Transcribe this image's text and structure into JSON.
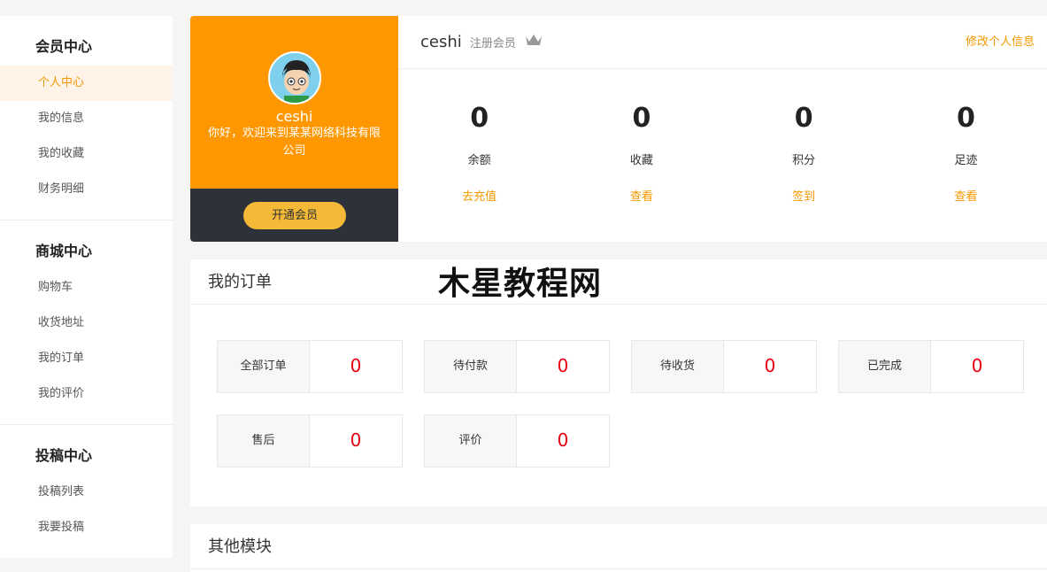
{
  "sidebar": {
    "groups": [
      {
        "title": "会员中心",
        "items": [
          "个人中心",
          "我的信息",
          "我的收藏",
          "财务明细"
        ]
      },
      {
        "title": "商城中心",
        "items": [
          "购物车",
          "收货地址",
          "我的订单",
          "我的评价"
        ]
      },
      {
        "title": "投稿中心",
        "items": [
          "投稿列表",
          "我要投稿"
        ]
      }
    ],
    "active_item": "个人中心"
  },
  "profile": {
    "name": "ceshi",
    "greeting": "你好，欢迎来到某某网络科技有限公司",
    "open_vip_label": "开通会员",
    "username": "ceshi",
    "level": "注册会员",
    "edit_label": "修改个人信息",
    "stats": [
      {
        "value": "0",
        "label": "余额",
        "link": "去充值"
      },
      {
        "value": "0",
        "label": "收藏",
        "link": "查看"
      },
      {
        "value": "0",
        "label": "积分",
        "link": "签到"
      },
      {
        "value": "0",
        "label": "足迹",
        "link": "查看"
      }
    ]
  },
  "orders": {
    "title": "我的订单",
    "watermark": "木星教程网",
    "items": [
      {
        "label": "全部订单",
        "count": "0"
      },
      {
        "label": "待付款",
        "count": "0"
      },
      {
        "label": "待收货",
        "count": "0"
      },
      {
        "label": "已完成",
        "count": "0"
      },
      {
        "label": "售后",
        "count": "0"
      },
      {
        "label": "评价",
        "count": "0"
      }
    ]
  },
  "other": {
    "title": "其他模块"
  },
  "colors": {
    "accent": "#f39800",
    "profile_bg": "#ff9700",
    "dark_bar": "#2d323a",
    "vip_button": "#f3b937",
    "count_red": "#e60012"
  }
}
